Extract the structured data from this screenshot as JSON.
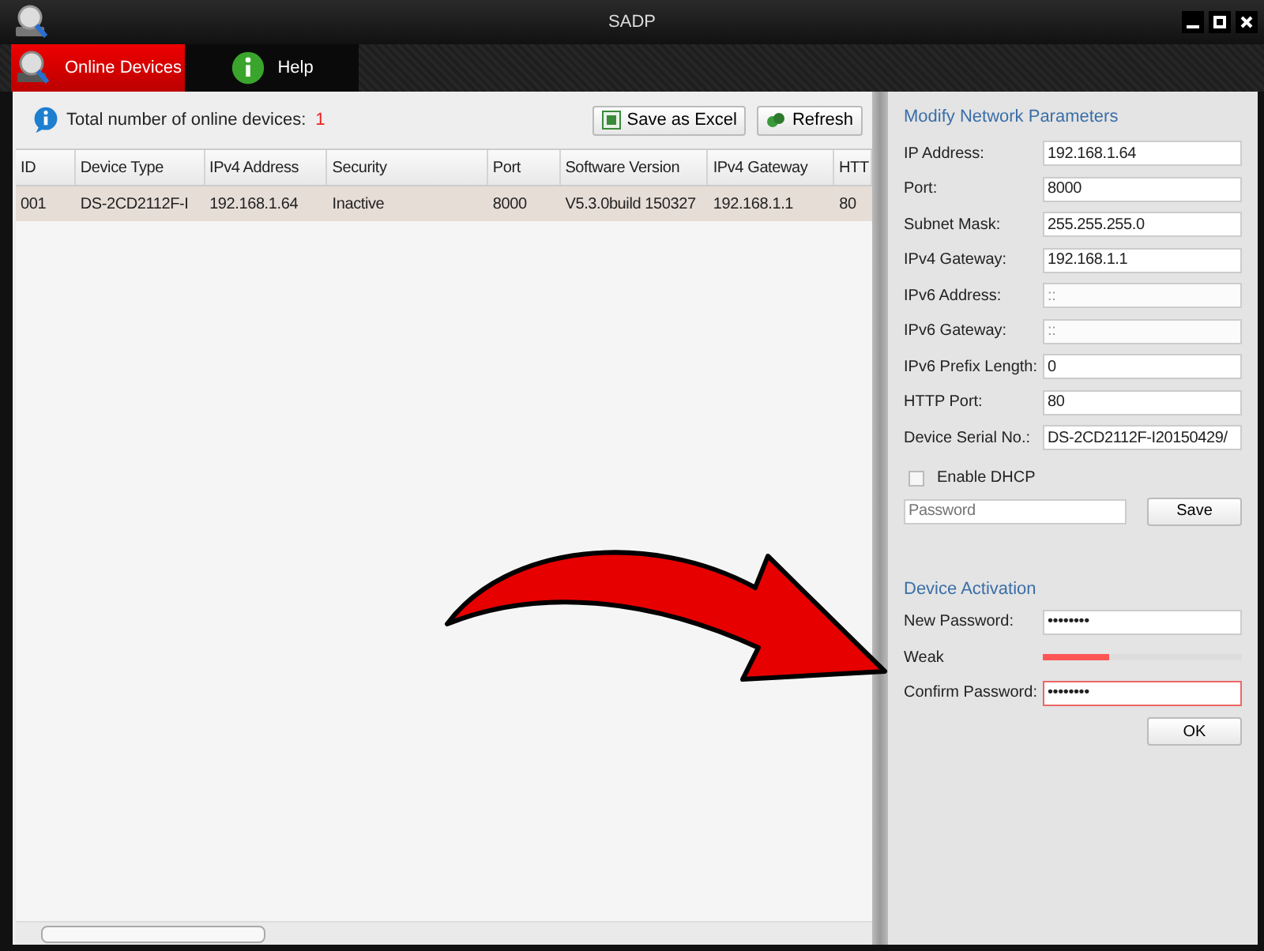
{
  "window": {
    "title": "SADP"
  },
  "tabs": [
    {
      "label": "Online Devices",
      "selected": true
    },
    {
      "label": "Help",
      "selected": false
    }
  ],
  "summary": {
    "label": "Total number of online devices:",
    "count": "1"
  },
  "toolbar": [
    {
      "label": "Save as Excel"
    },
    {
      "label": "Refresh"
    }
  ],
  "table": {
    "columns": [
      "ID",
      "Device Type",
      "IPv4 Address",
      "Security",
      "Port",
      "Software Version",
      "IPv4 Gateway",
      "HTT"
    ],
    "rows": [
      {
        "selected": true,
        "cells": [
          "001",
          "DS-2CD2112F-I",
          "192.168.1.64",
          "Inactive",
          "8000",
          "V5.3.0build 150327",
          "192.168.1.1",
          "80"
        ]
      }
    ]
  },
  "network": {
    "title": "Modify Network Parameters",
    "fields": [
      {
        "label": "IP Address:",
        "value": "192.168.1.64",
        "disabled": false
      },
      {
        "label": "Port:",
        "value": "8000",
        "disabled": false
      },
      {
        "label": "Subnet Mask:",
        "value": "255.255.255.0",
        "disabled": false
      },
      {
        "label": "IPv4 Gateway:",
        "value": "192.168.1.1",
        "disabled": false
      },
      {
        "label": "IPv6 Address:",
        "value": "::",
        "disabled": true
      },
      {
        "label": "IPv6 Gateway:",
        "value": "::",
        "disabled": true
      },
      {
        "label": "IPv6 Prefix Length:",
        "value": "0",
        "disabled": false
      },
      {
        "label": "HTTP Port:",
        "value": "80",
        "disabled": false
      },
      {
        "label": "Device Serial No.:",
        "value": "DS-2CD2112F-I20150429/",
        "disabled": false
      }
    ],
    "dhcp": {
      "label": "Enable DHCP",
      "checked": false
    },
    "password": {
      "placeholder": "Password"
    },
    "save": "Save"
  },
  "activation": {
    "title": "Device Activation",
    "new_password": {
      "label": "New Password:",
      "value": "••••••••",
      "highlighted": false
    },
    "strength": {
      "label": "Weak",
      "level": 0.33
    },
    "confirm_password": {
      "label": "Confirm Password:",
      "value": "••••••••",
      "highlighted": true
    },
    "ok": "OK"
  }
}
